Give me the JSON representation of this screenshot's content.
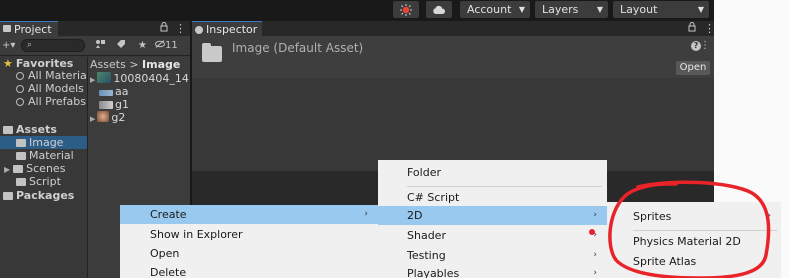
{
  "toolbar": {
    "account_label": "Account",
    "layers_label": "Layers",
    "layout_label": "Layout",
    "arrow": "▼"
  },
  "project": {
    "tab_label": "Project",
    "lock_icon": "ɑ",
    "kebab": "⋮",
    "search_placeholder": "⌕",
    "hidden_count": "11",
    "favorites": {
      "label": "Favorites",
      "items": [
        "All Materia",
        "All Models",
        "All Prefabs"
      ]
    },
    "assets": {
      "label": "Assets",
      "items": [
        "Image",
        "Material",
        "Scenes",
        "Script"
      ]
    },
    "packages_label": "Packages",
    "breadcrumb": {
      "root": "Assets",
      "sep": ">",
      "current": "Image"
    },
    "files": [
      "10080404_14",
      "aa",
      "g1",
      "g2"
    ]
  },
  "inspector": {
    "tab_label": "Inspector",
    "title": "Image (Default Asset)",
    "open_label": "Open",
    "help": "?",
    "kebab": "⋮"
  },
  "menu1": {
    "items": [
      "Create",
      "Show in Explorer",
      "Open",
      "Delete"
    ],
    "highlighted": "Create",
    "sub_arrow": "›"
  },
  "menu2": {
    "items": [
      "Folder",
      "C# Script",
      "2D",
      "Shader",
      "Testing",
      "Playables"
    ],
    "highlighted": "2D",
    "sub_arrow": "›"
  },
  "menu3": {
    "items": [
      "Sprites",
      "Physics Material 2D",
      "Sprite Atlas"
    ],
    "sub_arrow": "›"
  },
  "colors": {
    "menu_highlight": "#99c9ef",
    "selection": "#2c5d87",
    "annotation_red": "#e8232a"
  }
}
